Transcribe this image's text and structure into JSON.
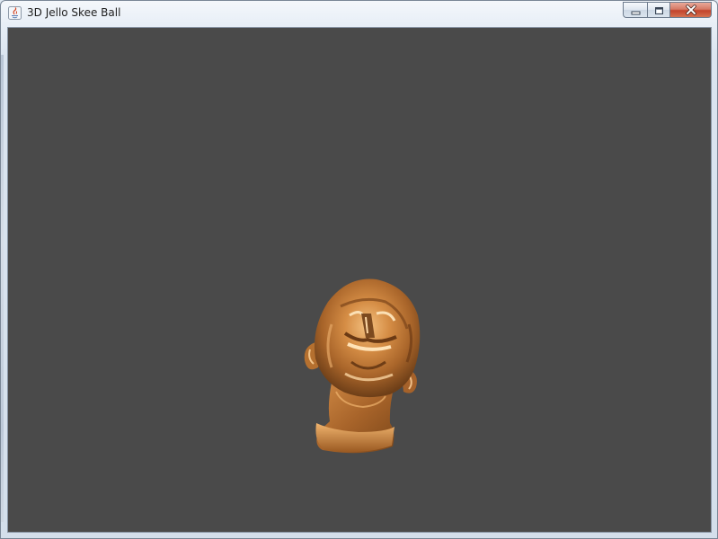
{
  "window": {
    "title": "3D Jello Skee Ball",
    "app_icon": "java-icon",
    "buttons": {
      "minimize": "minimize-icon",
      "maximize": "maximize-icon",
      "close": "close-icon"
    }
  },
  "scene": {
    "background_color": "#4a4a4a",
    "object": "bronze-head-model",
    "object_color": "#c8823f"
  }
}
